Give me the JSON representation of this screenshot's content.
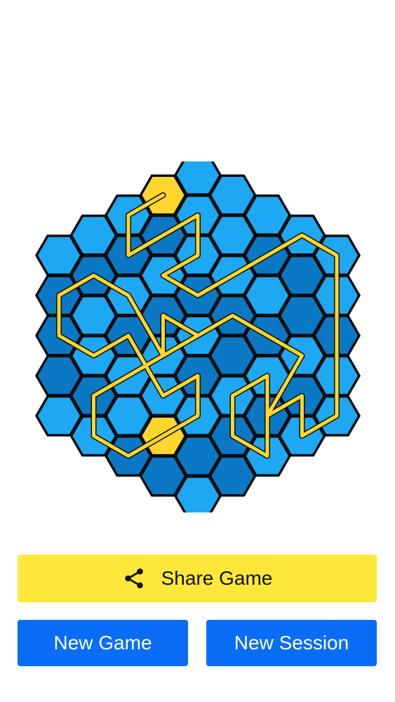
{
  "colors": {
    "background": "#ffffff",
    "hex_light": "#1ea7f2",
    "hex_dark": "#0a78c4",
    "hex_outline": "#0d0d0d",
    "path": "#ffd62e",
    "endpoint": "#ffd62e",
    "share_button": "#ffe83a",
    "primary_button": "#0a6df5"
  },
  "board": {
    "shape": "hexagon",
    "radius": 4,
    "dark_cells": [
      [
        -4,
        1
      ],
      [
        -4,
        2
      ],
      [
        -3,
        3
      ],
      [
        -2,
        1
      ],
      [
        -1,
        0
      ],
      [
        0,
        -1
      ],
      [
        1,
        -1
      ],
      [
        2,
        -3
      ],
      [
        3,
        -3
      ],
      [
        -2,
        4
      ],
      [
        -1,
        4
      ],
      [
        0,
        3
      ],
      [
        1,
        2
      ],
      [
        2,
        1
      ],
      [
        3,
        0
      ],
      [
        4,
        -2
      ],
      [
        -3,
        0
      ],
      [
        0,
        1
      ],
      [
        1,
        0
      ],
      [
        -1,
        -2
      ],
      [
        2,
        -1
      ],
      [
        -2,
        -1
      ],
      [
        3,
        -2
      ],
      [
        1,
        3
      ],
      [
        -4,
        3
      ]
    ],
    "endpoints": [
      [
        -1,
        -3
      ],
      [
        -1,
        3
      ]
    ],
    "path_cells": [
      [
        -1,
        -3
      ],
      [
        -2,
        -2
      ],
      [
        -2,
        -1
      ],
      [
        -1,
        -2
      ],
      [
        0,
        -3
      ],
      [
        0,
        -2
      ],
      [
        -1,
        -1
      ],
      [
        0,
        -1
      ],
      [
        1,
        -2
      ],
      [
        2,
        -3
      ],
      [
        3,
        -4
      ],
      [
        4,
        -4
      ],
      [
        4,
        -3
      ],
      [
        4,
        -2
      ],
      [
        4,
        -1
      ],
      [
        4,
        0
      ],
      [
        3,
        1
      ],
      [
        3,
        0
      ],
      [
        2,
        1
      ],
      [
        2,
        0
      ],
      [
        1,
        1
      ],
      [
        1,
        2
      ],
      [
        2,
        2
      ],
      [
        2,
        1
      ],
      [
        3,
        -1
      ],
      [
        2,
        -1
      ],
      [
        1,
        -1
      ],
      [
        0,
        0
      ],
      [
        -1,
        0
      ],
      [
        -1,
        1
      ],
      [
        -2,
        0
      ],
      [
        -3,
        0
      ],
      [
        -4,
        1
      ],
      [
        -4,
        2
      ],
      [
        -3,
        2
      ],
      [
        -2,
        1
      ],
      [
        -1,
        2
      ],
      [
        0,
        1
      ],
      [
        0,
        2
      ],
      [
        -1,
        3
      ],
      [
        -2,
        4
      ],
      [
        -3,
        4
      ],
      [
        -3,
        3
      ],
      [
        -2,
        2
      ],
      [
        -1,
        1
      ],
      [
        0,
        0
      ]
    ]
  },
  "share": {
    "label": "Share Game",
    "icon": "share-icon"
  },
  "buttons": {
    "new_game": "New Game",
    "new_session": "New Session"
  }
}
